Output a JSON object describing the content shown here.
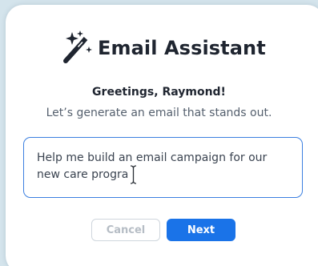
{
  "header": {
    "title": "Email Assistant",
    "icon": "magic-wand-sparkles-icon"
  },
  "greeting": "Greetings, Raymond!",
  "subtitle": "Let’s generate an email that stands out.",
  "prompt": {
    "value": "Help me build an email campaign for our new care progra"
  },
  "actions": {
    "cancel_label": "Cancel",
    "next_label": "Next"
  },
  "colors": {
    "primary": "#1a73e8",
    "input_border": "#3b7fe0",
    "title_text": "#1f2530",
    "background": "#d4e4ec"
  }
}
